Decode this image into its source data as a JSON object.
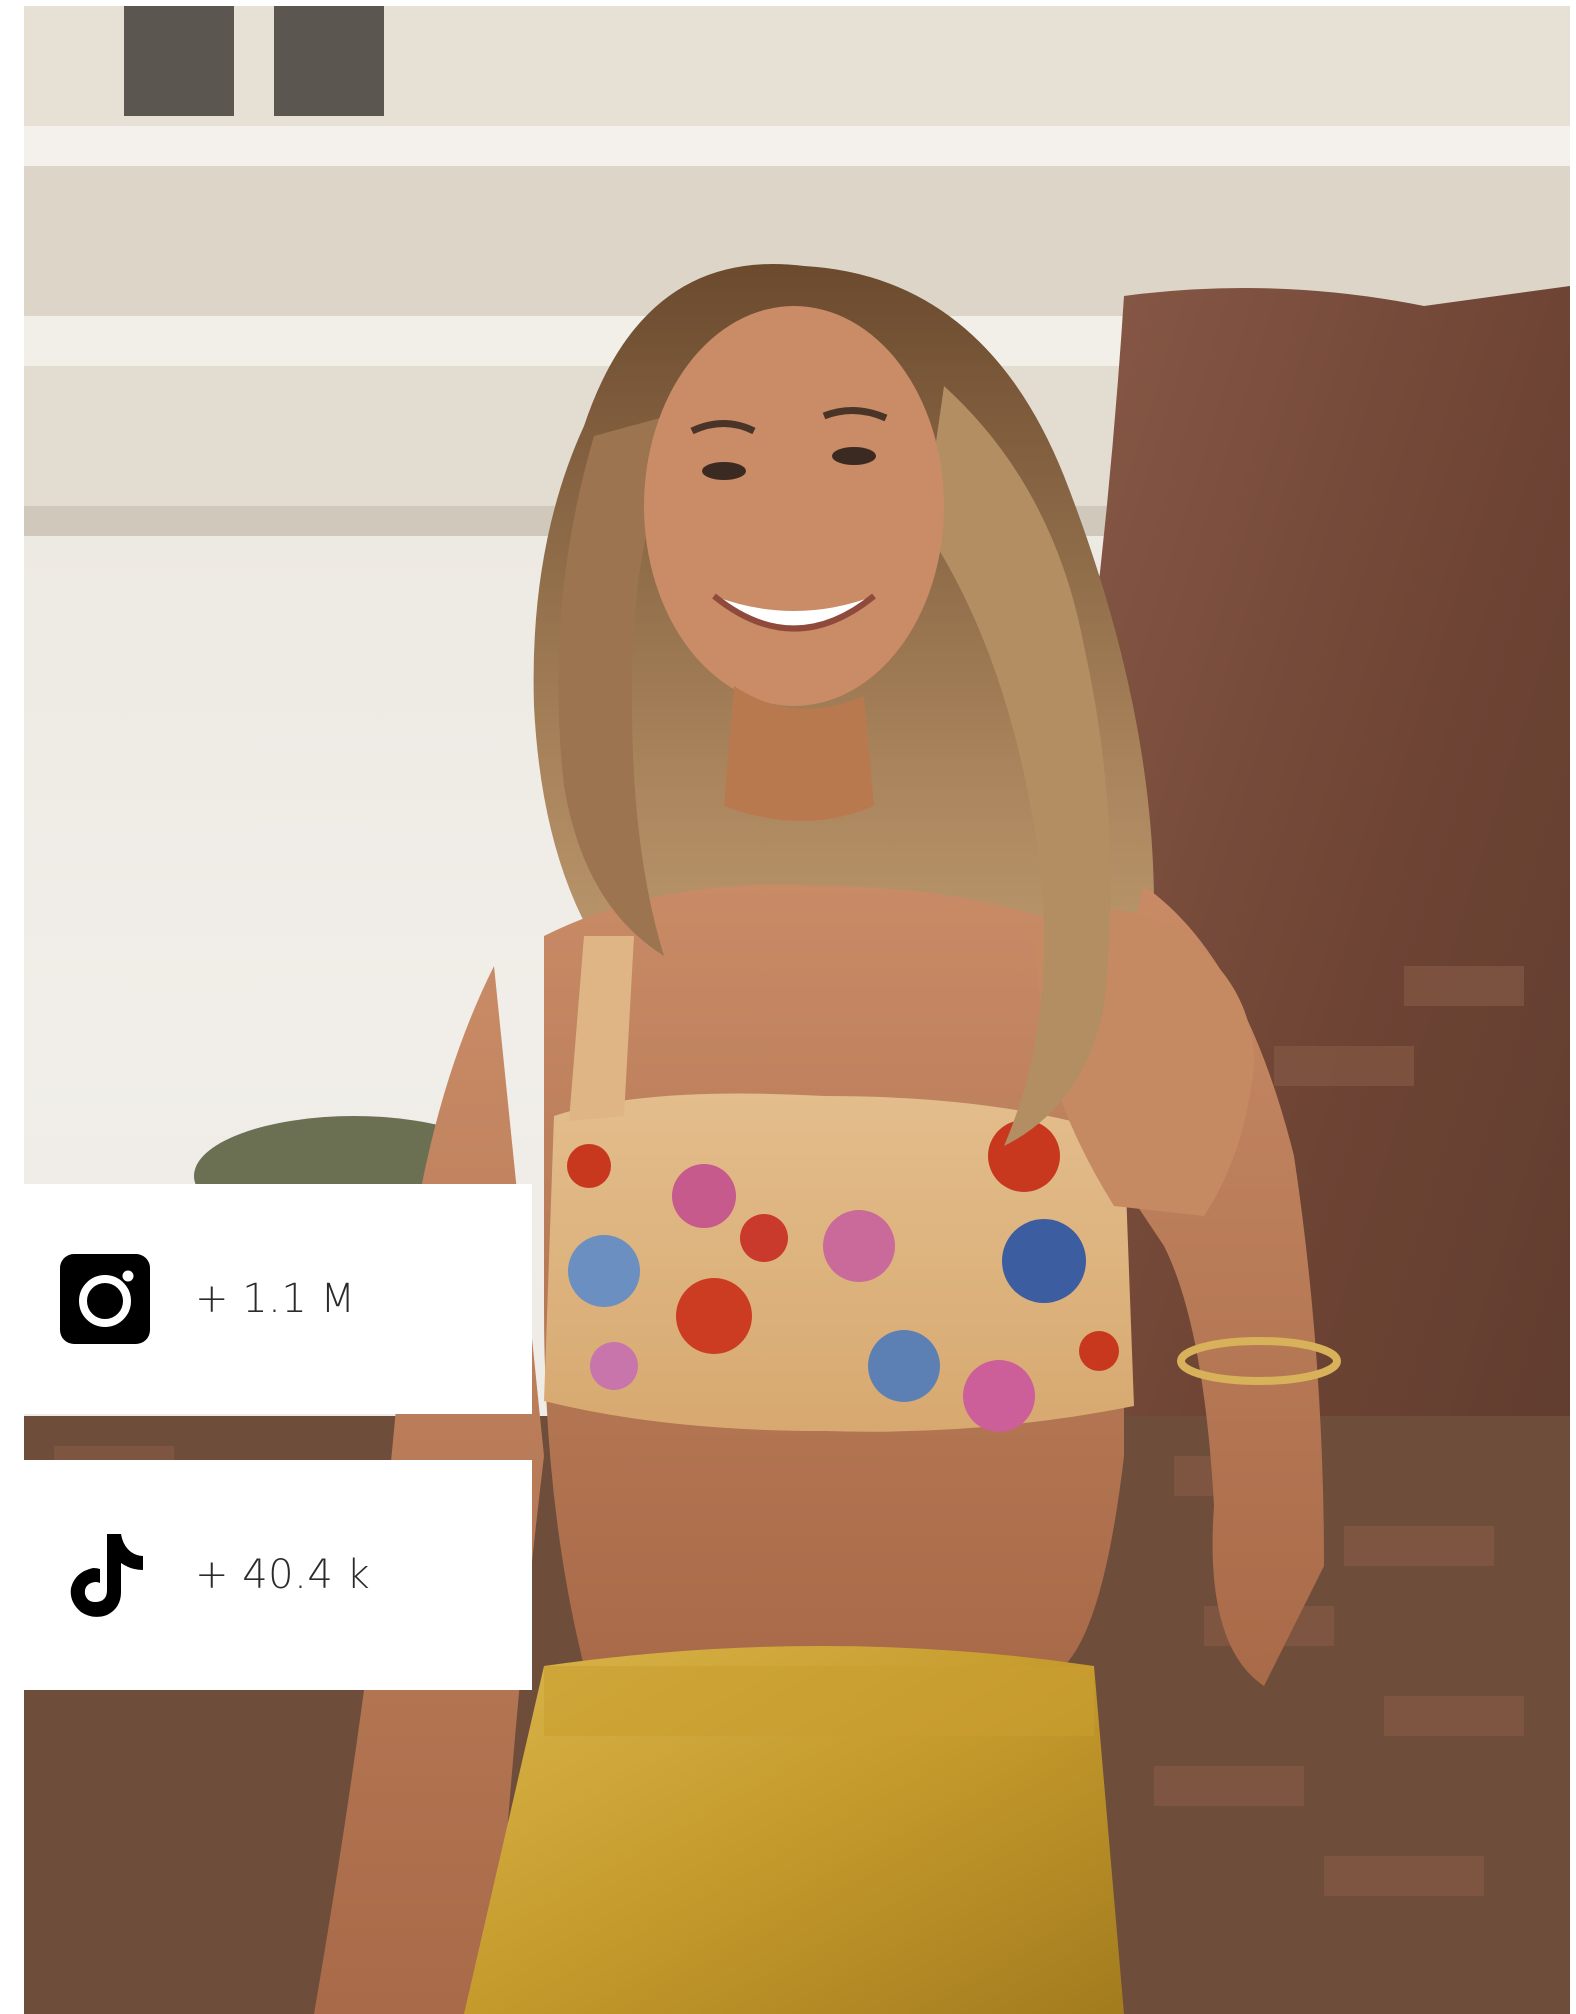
{
  "stats": [
    {
      "platform_icon": "instagram-icon",
      "value": "+ 1.1 M"
    },
    {
      "platform_icon": "tiktok-icon",
      "value": "+ 40.4 k"
    }
  ],
  "colors": {
    "card_background": "#ffffff",
    "icon_color": "#000000",
    "text_color": "#2b2b2b"
  }
}
